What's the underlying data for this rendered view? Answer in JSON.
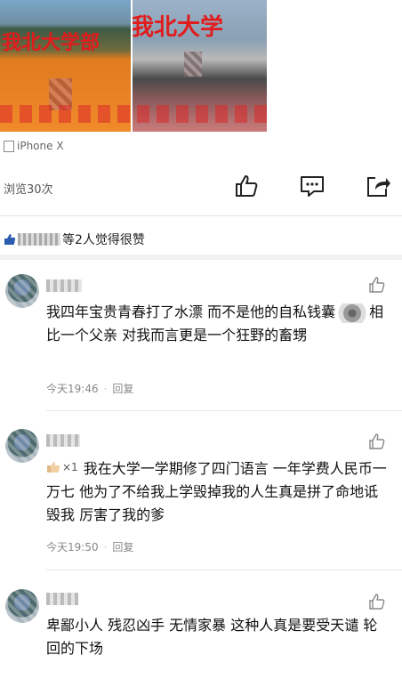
{
  "photos": {
    "left_banner": "我北大学部",
    "right_banner": "我北大学"
  },
  "device": {
    "label": "iPhone X"
  },
  "post": {
    "views": "浏览30次"
  },
  "likes": {
    "summary": "等2人觉得很赞"
  },
  "comments": [
    {
      "text_part1": "我四年宝贵青春打了水漂 而不是他的自私钱囊",
      "text_part2": "相比一个父亲 对我而言更是一个狂野的畜甥",
      "time": "今天19:46",
      "reply": "回复"
    },
    {
      "badge_count": "×1",
      "text": "我在大学一学期修了四门语言 一年学费人民币一万七 他为了不给我上学毁掉我的人生真是拼了命地诋毁我 厉害了我的爹",
      "time": "今天19:50",
      "reply": "回复"
    },
    {
      "text": "卑鄙小人 残忍凶手 无情家暴 这种人真是要受天谴 轮回的下场"
    }
  ],
  "icons": {
    "like": "thumbs-up-icon",
    "comment": "comment-icon",
    "share": "share-icon"
  },
  "colors": {
    "banner_red": "#e11c1c",
    "meta_gray": "#888888"
  }
}
